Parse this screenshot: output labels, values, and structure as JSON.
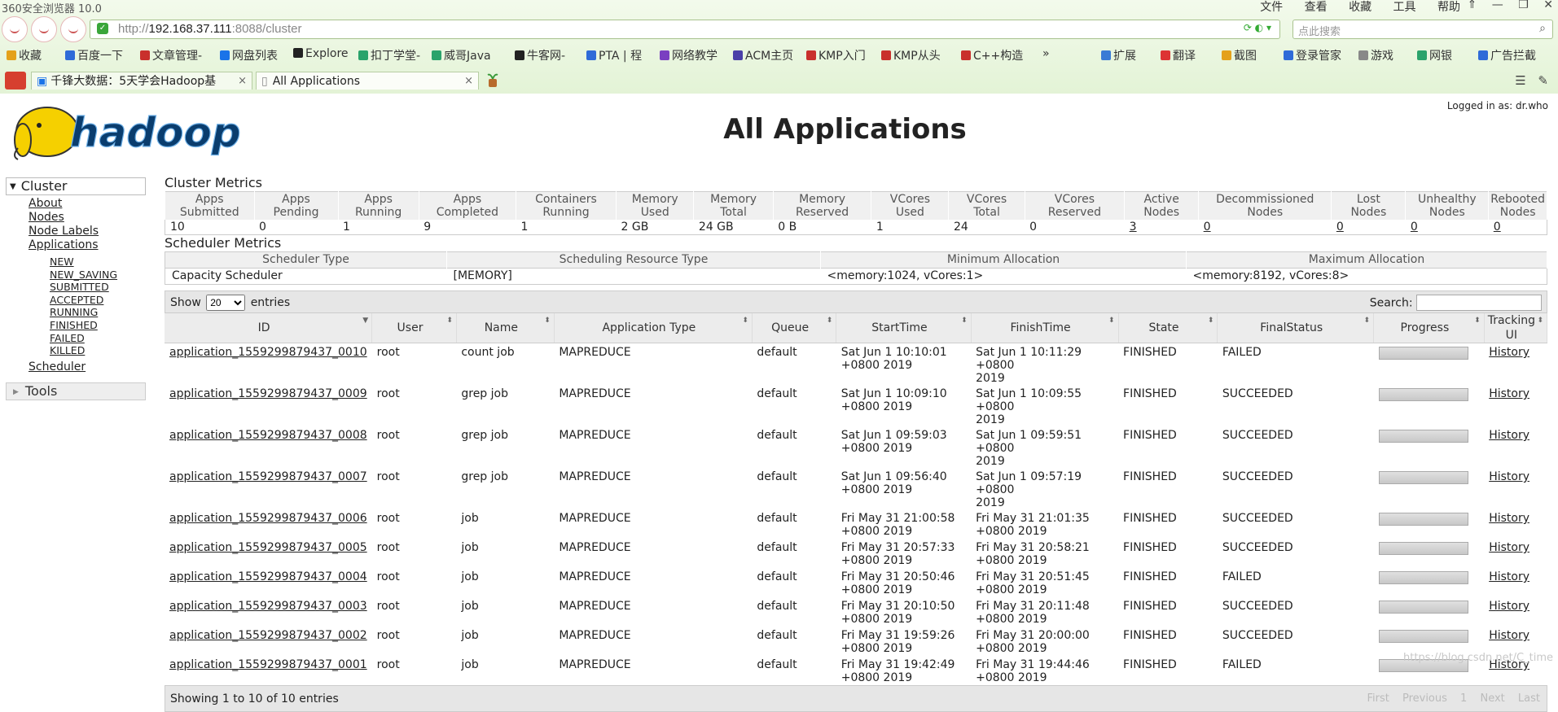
{
  "browser": {
    "title": "360安全浏览器 10.0",
    "menu": [
      "文件",
      "查看",
      "收藏",
      "工具",
      "帮助"
    ],
    "address": {
      "scheme": "http://",
      "host": "192.168.37.111",
      "rest": ":8088/cluster"
    },
    "search_placeholder": "点此搜索",
    "bookmarks": [
      {
        "label": "收藏",
        "color": "#e4a11b"
      },
      {
        "label": "百度一下",
        "color": "#2f6bd8"
      },
      {
        "label": "文章管理-",
        "color": "#c9302c"
      },
      {
        "label": "网盘列表",
        "color": "#1a73e8"
      },
      {
        "label": "Explore",
        "color": "#222222"
      },
      {
        "label": "扣丁学堂-",
        "color": "#2aa36b"
      },
      {
        "label": "威哥Java",
        "color": "#2aa36b"
      },
      {
        "label": "牛客网-",
        "color": "#222222"
      },
      {
        "label": "PTA | 程",
        "color": "#2f6bd8"
      },
      {
        "label": "网络教学",
        "color": "#7a3fc1"
      },
      {
        "label": "ACM主页",
        "color": "#4a3fa8"
      },
      {
        "label": "KMP入门",
        "color": "#c9302c"
      },
      {
        "label": "KMP从头",
        "color": "#c9302c"
      },
      {
        "label": "C++构造",
        "color": "#c9302c"
      }
    ],
    "bookmarks_right": [
      "扩展",
      "翻译",
      "截图",
      "登录管家",
      "游戏",
      "网银",
      "广告拦截"
    ],
    "tabs": [
      {
        "label": "千锋大数据：5天学会Hadoop基"
      },
      {
        "label": "All Applications"
      }
    ]
  },
  "page": {
    "title": "All Applications",
    "logged_in": "Logged in as: dr.who",
    "logo_text": "hadoop"
  },
  "sidebar": {
    "cluster_label": "Cluster",
    "items": [
      "About",
      "Nodes",
      "Node Labels",
      "Applications"
    ],
    "states": [
      "NEW",
      "NEW_SAVING",
      "SUBMITTED",
      "ACCEPTED",
      "RUNNING",
      "FINISHED",
      "FAILED",
      "KILLED"
    ],
    "scheduler": "Scheduler",
    "tools_label": "Tools"
  },
  "cluster_metrics": {
    "title": "Cluster Metrics",
    "headers": [
      [
        "Apps",
        "Submitted"
      ],
      [
        "Apps",
        "Pending"
      ],
      [
        "Apps",
        "Running"
      ],
      [
        "Apps",
        "Completed"
      ],
      [
        "Containers",
        "Running"
      ],
      [
        "Memory",
        "Used"
      ],
      [
        "Memory",
        "Total"
      ],
      [
        "Memory",
        "Reserved"
      ],
      [
        "VCores",
        "Used"
      ],
      [
        "VCores",
        "Total"
      ],
      [
        "VCores",
        "Reserved"
      ],
      [
        "Active",
        "Nodes"
      ],
      [
        "Decommissioned",
        "Nodes"
      ],
      [
        "Lost",
        "Nodes"
      ],
      [
        "Unhealthy",
        "Nodes"
      ],
      [
        "Rebooted",
        "Nodes"
      ]
    ],
    "values": [
      "10",
      "0",
      "1",
      "9",
      "1",
      "2 GB",
      "24 GB",
      "0 B",
      "1",
      "24",
      "0",
      "3",
      "0",
      "0",
      "0",
      "0"
    ],
    "linked": [
      false,
      false,
      false,
      false,
      false,
      false,
      false,
      false,
      false,
      false,
      false,
      true,
      true,
      true,
      true,
      true
    ]
  },
  "scheduler_metrics": {
    "title": "Scheduler Metrics",
    "headers": [
      "Scheduler Type",
      "Scheduling Resource Type",
      "Minimum Allocation",
      "Maximum Allocation"
    ],
    "values": [
      "Capacity Scheduler",
      "[MEMORY]",
      "<memory:1024, vCores:1>",
      "<memory:8192, vCores:8>"
    ]
  },
  "datatable": {
    "show_label": "Show",
    "page_size": "20",
    "entries_label": "entries",
    "search_label": "Search:",
    "headers": [
      "ID",
      "User",
      "Name",
      "Application Type",
      "Queue",
      "StartTime",
      "FinishTime",
      "State",
      "FinalStatus",
      "Progress",
      "Tracking UI"
    ],
    "rows": [
      {
        "id": "application_1559299879437_0010",
        "user": "root",
        "name": "count job",
        "type": "MAPREDUCE",
        "queue": "default",
        "start1": "Sat Jun 1 10:10:01",
        "start2": "+0800 2019",
        "finish1": "Sat Jun 1 10:11:29 +0800",
        "finish2": "2019",
        "state": "FINISHED",
        "final": "FAILED",
        "progress": 0,
        "tracking": "History"
      },
      {
        "id": "application_1559299879437_0009",
        "user": "root",
        "name": "grep job",
        "type": "MAPREDUCE",
        "queue": "default",
        "start1": "Sat Jun 1 10:09:10",
        "start2": "+0800 2019",
        "finish1": "Sat Jun 1 10:09:55 +0800",
        "finish2": "2019",
        "state": "FINISHED",
        "final": "SUCCEEDED",
        "progress": 0,
        "tracking": "History"
      },
      {
        "id": "application_1559299879437_0008",
        "user": "root",
        "name": "grep job",
        "type": "MAPREDUCE",
        "queue": "default",
        "start1": "Sat Jun 1 09:59:03",
        "start2": "+0800 2019",
        "finish1": "Sat Jun 1 09:59:51 +0800",
        "finish2": "2019",
        "state": "FINISHED",
        "final": "SUCCEEDED",
        "progress": 0,
        "tracking": "History"
      },
      {
        "id": "application_1559299879437_0007",
        "user": "root",
        "name": "grep job",
        "type": "MAPREDUCE",
        "queue": "default",
        "start1": "Sat Jun 1 09:56:40",
        "start2": "+0800 2019",
        "finish1": "Sat Jun 1 09:57:19 +0800",
        "finish2": "2019",
        "state": "FINISHED",
        "final": "SUCCEEDED",
        "progress": 0,
        "tracking": "History"
      },
      {
        "id": "application_1559299879437_0006",
        "user": "root",
        "name": "job",
        "type": "MAPREDUCE",
        "queue": "default",
        "start1": "Fri May 31 21:00:58",
        "start2": "+0800 2019",
        "finish1": "Fri May 31 21:01:35",
        "finish2": "+0800 2019",
        "state": "FINISHED",
        "final": "SUCCEEDED",
        "progress": 0,
        "tracking": "History"
      },
      {
        "id": "application_1559299879437_0005",
        "user": "root",
        "name": "job",
        "type": "MAPREDUCE",
        "queue": "default",
        "start1": "Fri May 31 20:57:33",
        "start2": "+0800 2019",
        "finish1": "Fri May 31 20:58:21",
        "finish2": "+0800 2019",
        "state": "FINISHED",
        "final": "SUCCEEDED",
        "progress": 0,
        "tracking": "History"
      },
      {
        "id": "application_1559299879437_0004",
        "user": "root",
        "name": "job",
        "type": "MAPREDUCE",
        "queue": "default",
        "start1": "Fri May 31 20:50:46",
        "start2": "+0800 2019",
        "finish1": "Fri May 31 20:51:45",
        "finish2": "+0800 2019",
        "state": "FINISHED",
        "final": "FAILED",
        "progress": 0,
        "tracking": "History"
      },
      {
        "id": "application_1559299879437_0003",
        "user": "root",
        "name": "job",
        "type": "MAPREDUCE",
        "queue": "default",
        "start1": "Fri May 31 20:10:50",
        "start2": "+0800 2019",
        "finish1": "Fri May 31 20:11:48",
        "finish2": "+0800 2019",
        "state": "FINISHED",
        "final": "SUCCEEDED",
        "progress": 0,
        "tracking": "History"
      },
      {
        "id": "application_1559299879437_0002",
        "user": "root",
        "name": "job",
        "type": "MAPREDUCE",
        "queue": "default",
        "start1": "Fri May 31 19:59:26",
        "start2": "+0800 2019",
        "finish1": "Fri May 31 20:00:00",
        "finish2": "+0800 2019",
        "state": "FINISHED",
        "final": "SUCCEEDED",
        "progress": 0,
        "tracking": "History"
      },
      {
        "id": "application_1559299879437_0001",
        "user": "root",
        "name": "job",
        "type": "MAPREDUCE",
        "queue": "default",
        "start1": "Fri May 31 19:42:49",
        "start2": "+0800 2019",
        "finish1": "Fri May 31 19:44:46",
        "finish2": "+0800 2019",
        "state": "FINISHED",
        "final": "FAILED",
        "progress": 0,
        "tracking": "History"
      }
    ],
    "info": "Showing 1 to 10 of 10 entries",
    "pager": [
      "First",
      "Previous",
      "1",
      "Next",
      "Last"
    ],
    "watermark": "https://blog.csdn.net/C_time"
  }
}
